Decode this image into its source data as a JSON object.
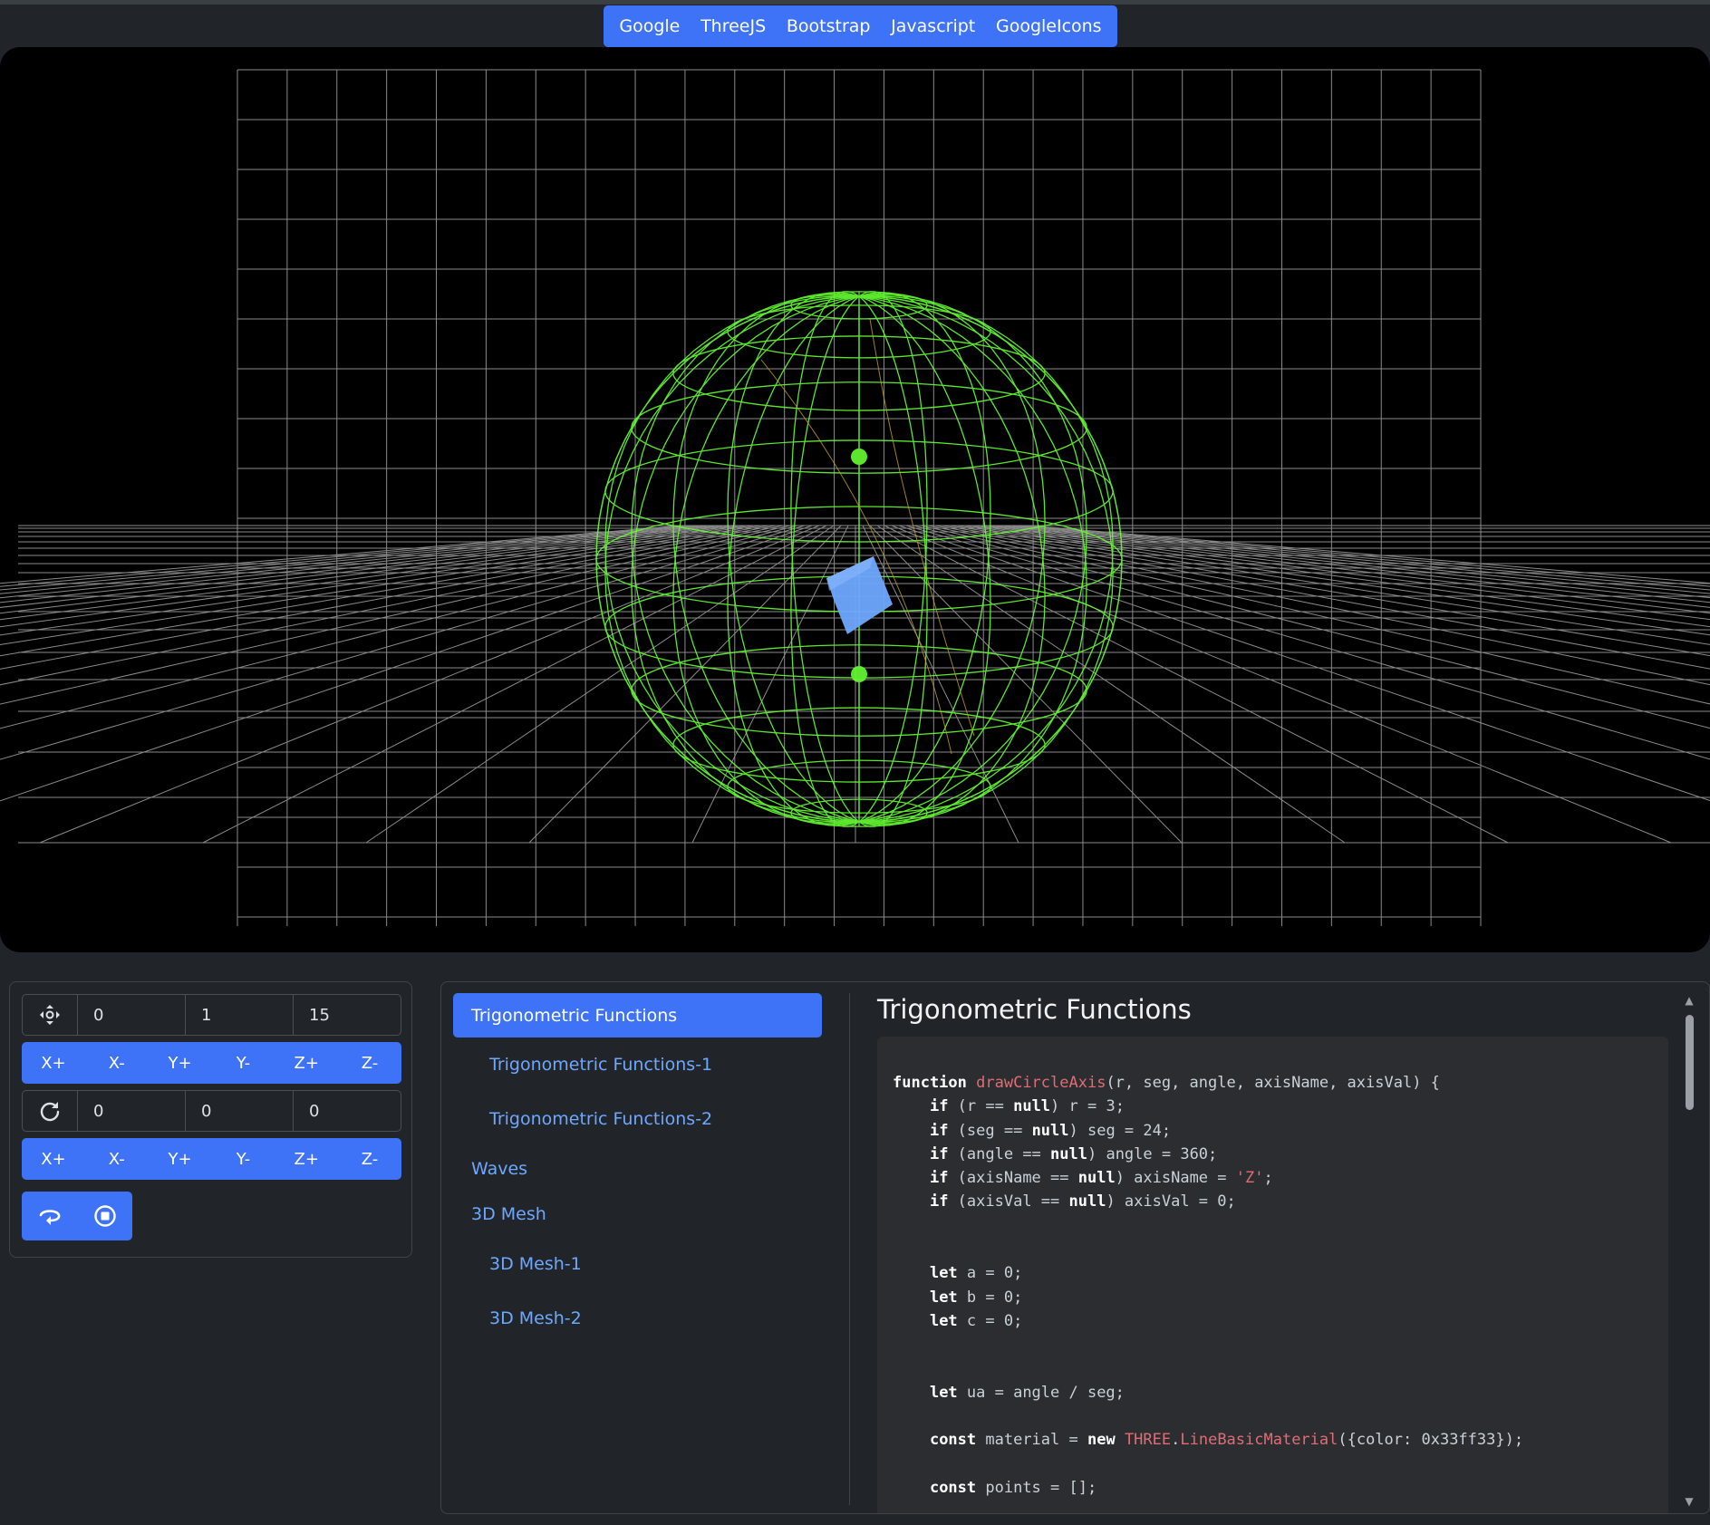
{
  "nav": {
    "links": [
      "Google",
      "ThreeJS",
      "Bootstrap",
      "Javascript",
      "GoogleIcons"
    ]
  },
  "controls": {
    "position": {
      "icon": "move-icon",
      "x": "0",
      "y": "1",
      "z": "15"
    },
    "position_buttons": [
      "X+",
      "X-",
      "Y+",
      "Y-",
      "Z+",
      "Z-"
    ],
    "rotation": {
      "icon": "rotate-icon",
      "x": "0",
      "y": "0",
      "z": "0"
    },
    "rotation_buttons": [
      "X+",
      "X-",
      "Y+",
      "Y-",
      "Z+",
      "Z-"
    ],
    "playback": {
      "rotate_icon": "rotate-left-icon",
      "stop_icon": "stop-circle-icon"
    }
  },
  "sidebar": {
    "active": "Trigonometric Functions",
    "items": [
      {
        "label": "Trigonometric Functions-1",
        "level": 2
      },
      {
        "label": "Trigonometric Functions-2",
        "level": 2
      },
      {
        "label": "Waves",
        "level": 1
      },
      {
        "label": "3D Mesh",
        "level": 1
      },
      {
        "label": "3D Mesh-1",
        "level": 2
      },
      {
        "label": "3D Mesh-2",
        "level": 2
      }
    ]
  },
  "main": {
    "title": "Trigonometric Functions",
    "code": [
      "function drawCircleAxis(r, seg, angle, axisName, axisVal) {",
      "    if (r == null) r = 3;",
      "    if (seg == null) seg = 24;",
      "    if (angle == null) angle = 360;",
      "    if (axisName == null) axisName = 'Z';",
      "    if (axisVal == null) axisVal = 0;",
      "",
      "",
      "    let a = 0;",
      "    let b = 0;",
      "    let c = 0;",
      "",
      "",
      "    let ua = angle / seg;",
      "",
      "    const material = new THREE.LineBasicMaterial({color: 0x33ff33});",
      "",
      "    const points = [];"
    ]
  },
  "colors": {
    "accent": "#3f73f7",
    "sphere": "#66ff33",
    "cube": "#6ea8fe",
    "grid": "#9a9a9a",
    "background": "#212529"
  }
}
